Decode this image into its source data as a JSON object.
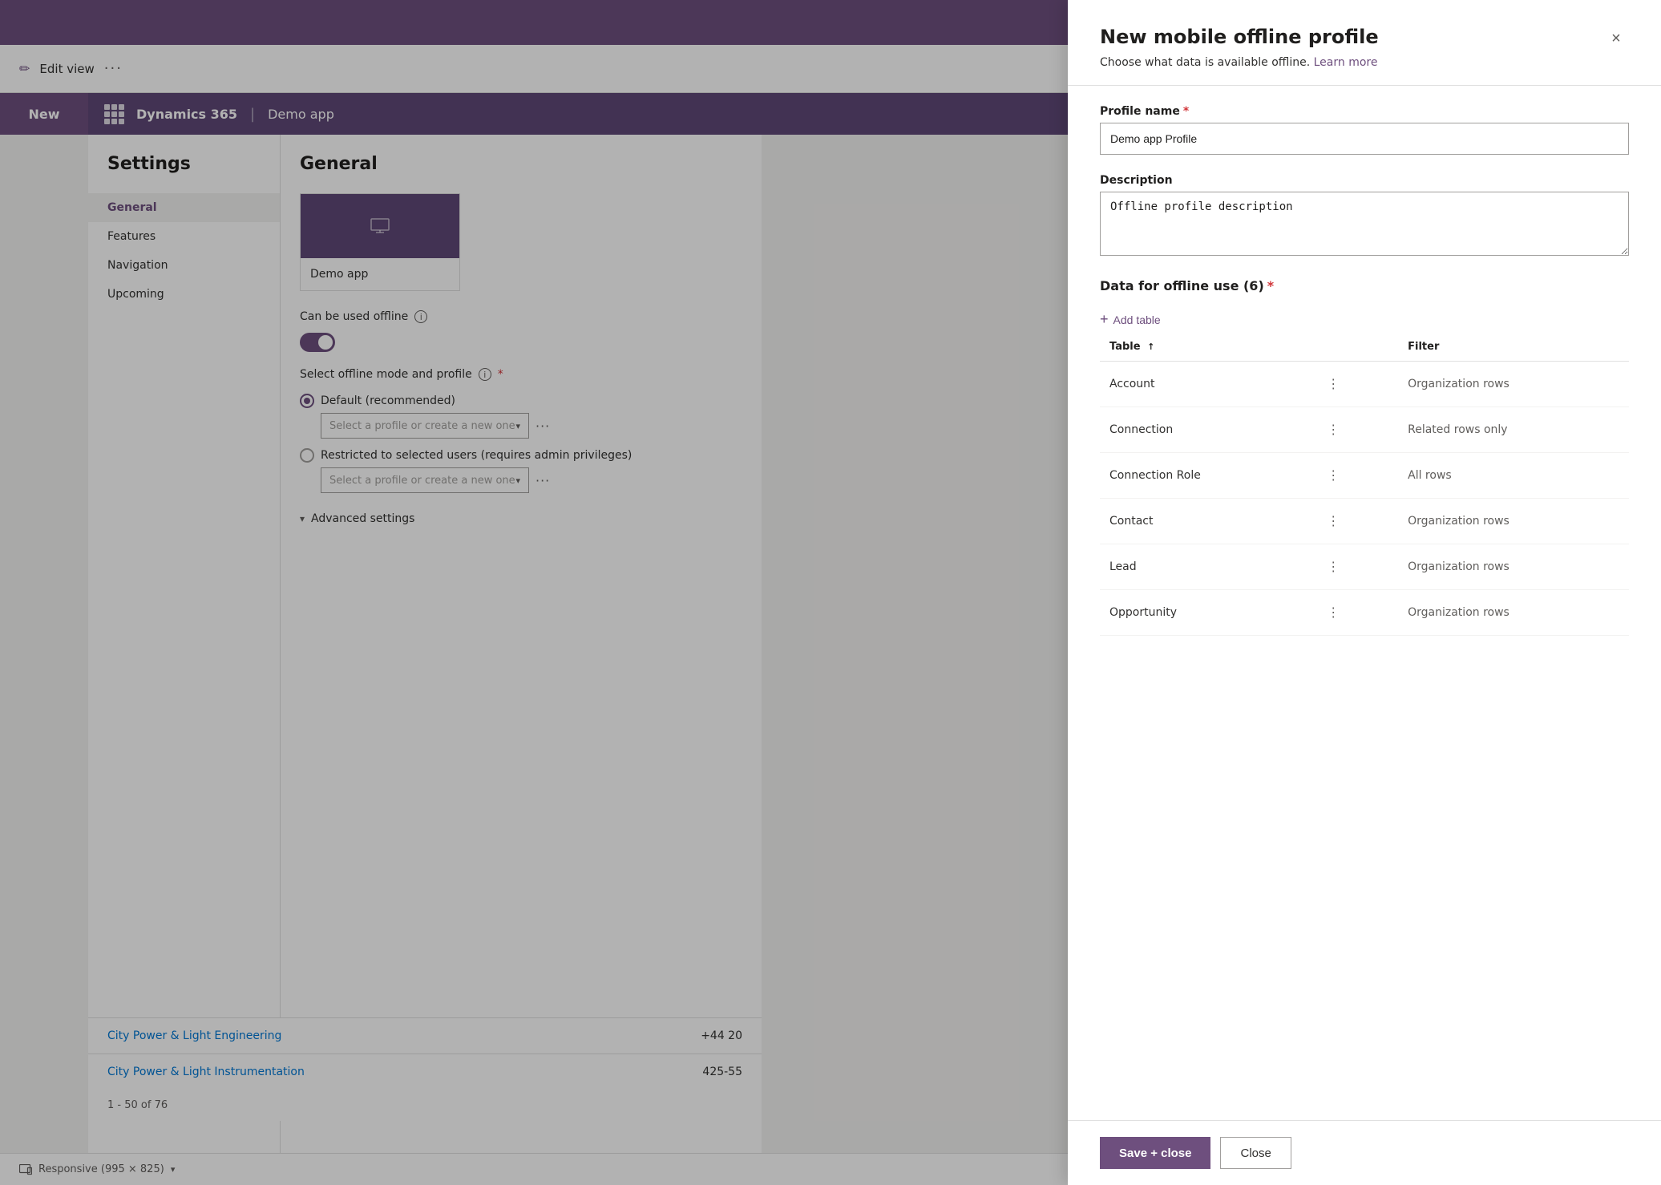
{
  "app": {
    "top_banner_color": "#6e4f7e",
    "edit_view_label": "Edit view",
    "ellipsis": "···",
    "dynamics_title": "Dynamics 365",
    "app_name": "Demo app"
  },
  "new_button": {
    "label": "New"
  },
  "settings": {
    "title": "Settings",
    "nav_items": [
      {
        "id": "general",
        "label": "General",
        "active": true
      },
      {
        "id": "features",
        "label": "Features",
        "active": false
      },
      {
        "id": "navigation",
        "label": "Navigation",
        "active": false
      },
      {
        "id": "upcoming",
        "label": "Upcoming",
        "active": false
      }
    ]
  },
  "general": {
    "title": "General",
    "app_card_name": "Demo app",
    "offline_label": "Can be used offline",
    "profile_section_label": "Select offline mode and profile",
    "default_option_label": "Default (recommended)",
    "restricted_option_label": "Restricted to selected users (requires admin privileges)",
    "profile_placeholder": "Select a profile or create a new one",
    "profile_placeholder_2": "Select a profile or create a new one",
    "advanced_settings_label": "Advanced settings"
  },
  "data_rows": [
    {
      "name": "City Power & Light Engineering",
      "phone": "+44 20"
    },
    {
      "name": "City Power & Light Instrumentation",
      "phone": "425-55"
    }
  ],
  "pagination": {
    "label": "1 - 50 of 76"
  },
  "bottom_bar": {
    "label": "Responsive (995 × 825)"
  },
  "modal": {
    "title": "New mobile offline profile",
    "subtitle": "Choose what data is available offline.",
    "learn_more": "Learn more",
    "close_label": "×",
    "profile_name_label": "Profile name",
    "profile_name_required": true,
    "profile_name_value": "Demo app Profile",
    "description_label": "Description",
    "description_value": "Offline profile description",
    "offline_data_title": "Data for offline use (6)",
    "offline_data_required": true,
    "add_table_label": "Add table",
    "table_header_table": "Table",
    "table_header_filter": "Filter",
    "sort_arrow": "↑",
    "table_rows": [
      {
        "table_name": "Account",
        "filter": "Organization rows"
      },
      {
        "table_name": "Connection",
        "filter": "Related rows only"
      },
      {
        "table_name": "Connection Role",
        "filter": "All rows"
      },
      {
        "table_name": "Contact",
        "filter": "Organization rows"
      },
      {
        "table_name": "Lead",
        "filter": "Organization rows"
      },
      {
        "table_name": "Opportunity",
        "filter": "Organization rows"
      }
    ],
    "save_close_label": "Save + close",
    "close_btn_label": "Close"
  }
}
